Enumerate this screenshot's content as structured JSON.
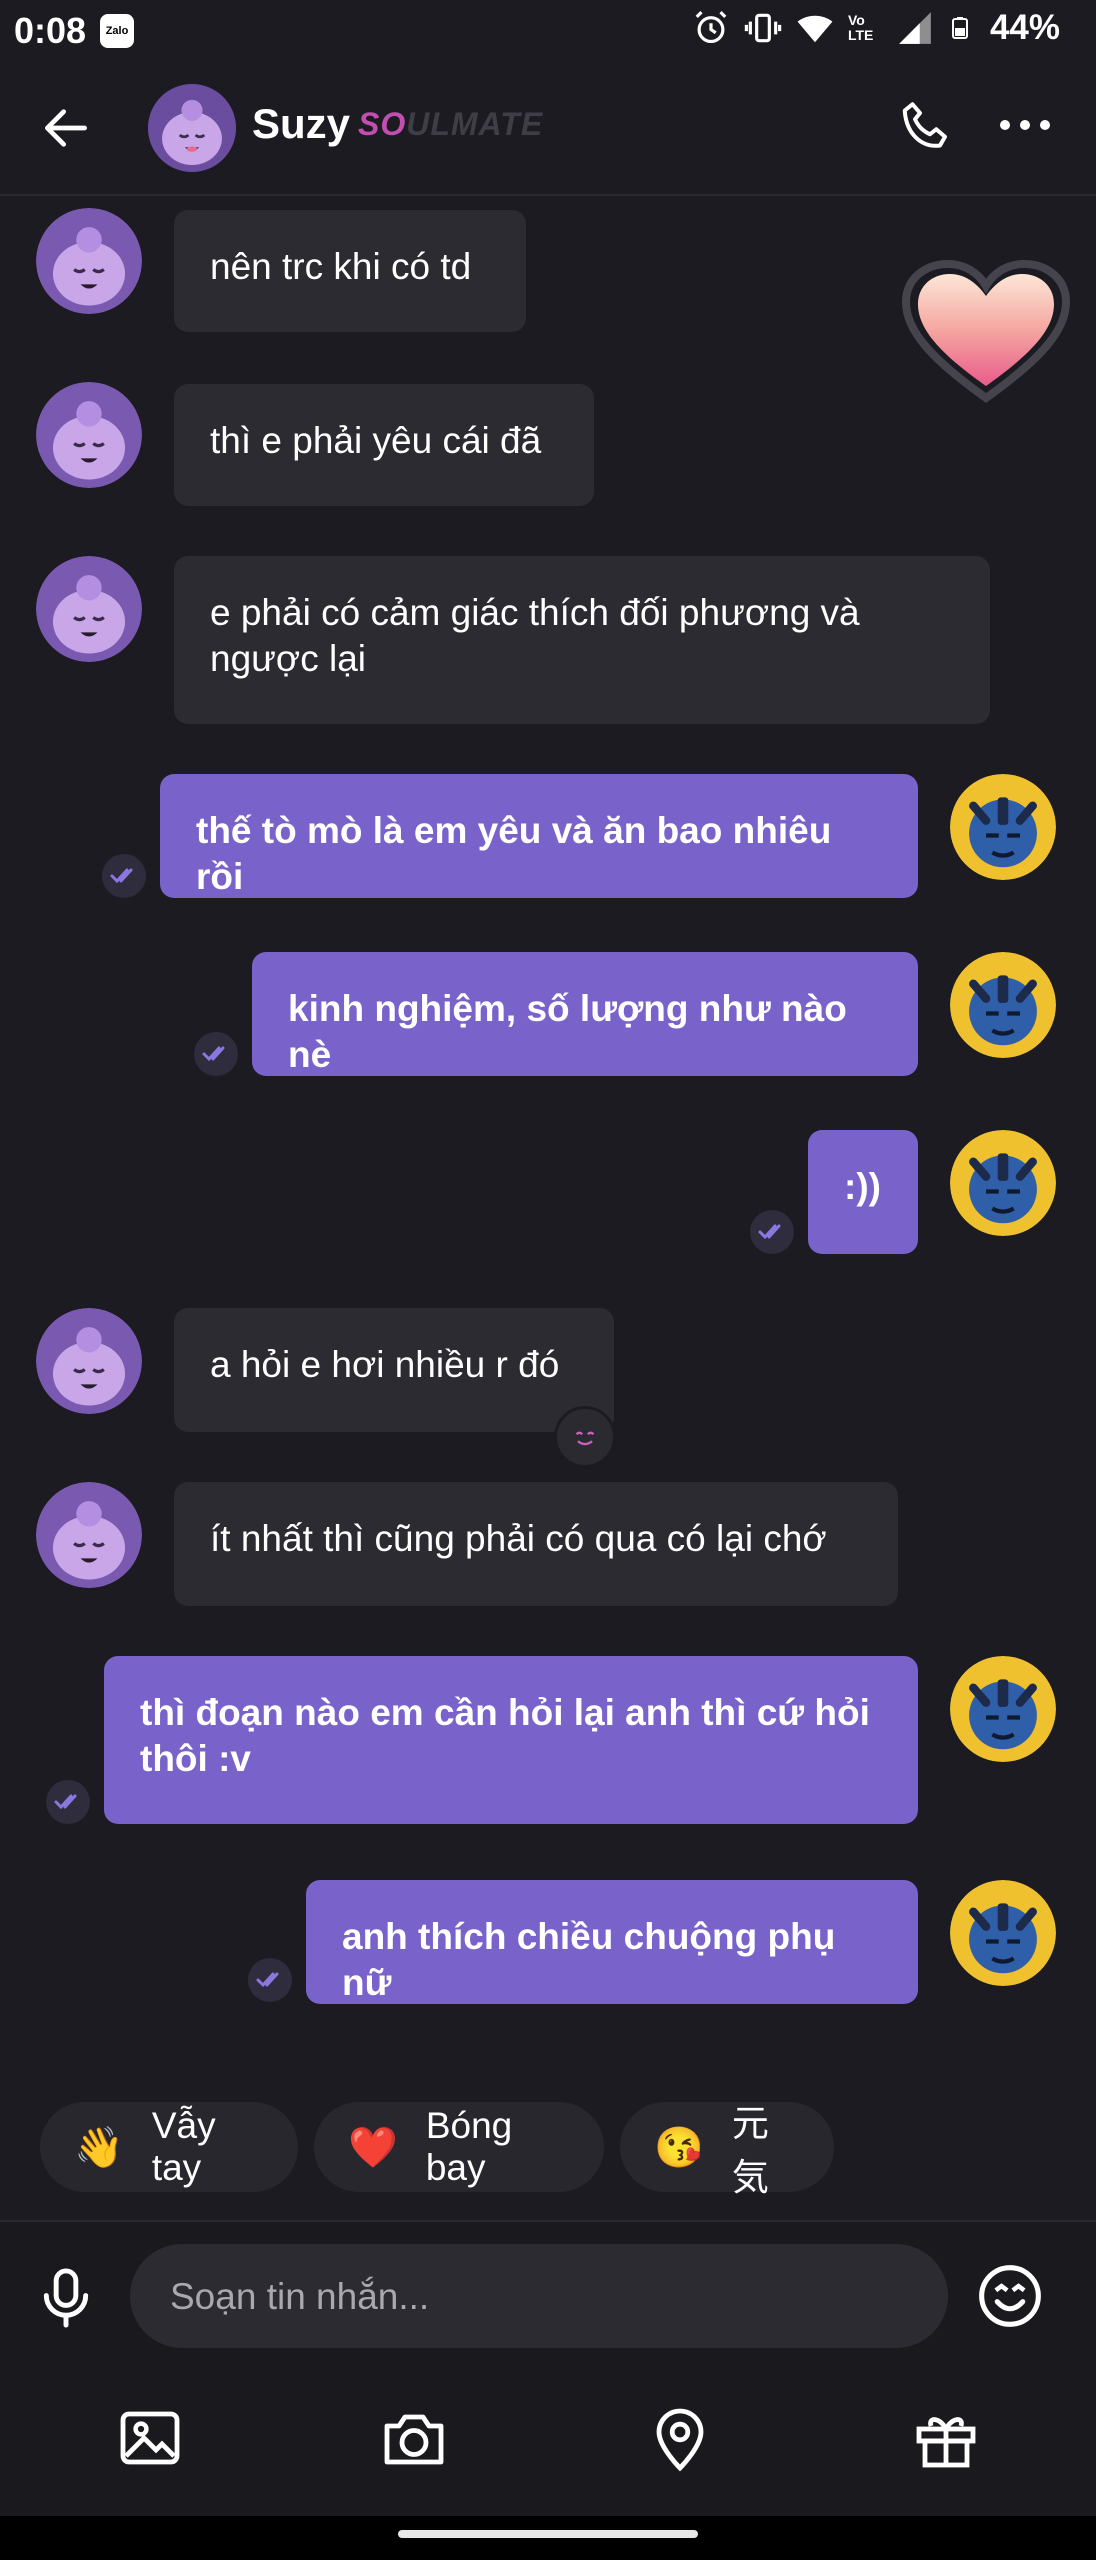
{
  "status_bar": {
    "time": "0:08",
    "zalo_label": "Zalo",
    "network_label": "Vo LTE",
    "battery": "44%"
  },
  "header": {
    "contact_name": "Suzy",
    "badge_prefix": "SO",
    "badge_suffix": "ULMATE"
  },
  "messages": [
    {
      "direction": "in",
      "text": "nên trc khi có td"
    },
    {
      "direction": "in",
      "text": "thì e phải yêu cái đã"
    },
    {
      "direction": "in",
      "text": "e phải có cảm giác thích đối phương và ngược lại"
    },
    {
      "direction": "out",
      "text": "thế tò mò là em yêu và ăn bao nhiêu rồi"
    },
    {
      "direction": "out",
      "text": "kinh nghiệm, số lượng như nào nè"
    },
    {
      "direction": "out",
      "text": ":))"
    },
    {
      "direction": "in",
      "text": "a hỏi e hơi nhiều r đó"
    },
    {
      "direction": "in",
      "text": "ít nhất thì cũng phải có qua có lại chớ"
    },
    {
      "direction": "out",
      "text": "thì đoạn nào em cần hỏi lại anh thì cứ hỏi thôi :v"
    },
    {
      "direction": "out",
      "text": "anh thích chiều chuộng phụ nữ"
    }
  ],
  "quick_replies": [
    {
      "emoji": "👋",
      "label": "Vẫy tay"
    },
    {
      "emoji": "❤️",
      "label": "Bóng bay"
    },
    {
      "emoji": "😘",
      "label": "元気"
    }
  ],
  "composer": {
    "placeholder": "Soạn tin nhắn..."
  },
  "colors": {
    "background": "#1c1b21",
    "incoming_bubble": "#2c2b31",
    "outgoing_bubble": "#7962c9",
    "badge_pink": "#c04fb0"
  },
  "icons": [
    "back-arrow-icon",
    "phone-icon",
    "more-icon",
    "read-check-icon",
    "heart-icon",
    "mic-icon",
    "emoji-icon",
    "image-icon",
    "camera-icon",
    "location-icon",
    "gift-icon"
  ]
}
